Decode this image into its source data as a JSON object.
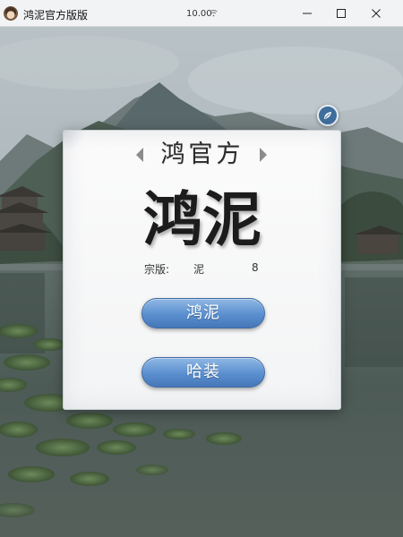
{
  "window": {
    "title": "鸿泥官方版版",
    "clock": "10.00",
    "minimize_icon": "minimize-icon",
    "maximize_icon": "maximize-icon",
    "close_icon": "close-icon"
  },
  "dialog": {
    "selector_label": "鸿官方",
    "title": "鸿泥",
    "info_label": "宗版:",
    "info_middle": "泥",
    "info_value": "8",
    "primary_button": "鸿泥",
    "secondary_button": "哈装"
  },
  "colors": {
    "button_blue": "#5a8fcf",
    "badge_blue": "#3f6e9c",
    "dialog_bg": "#f5f6f7",
    "titlebar_bg": "#f2f3f4"
  }
}
